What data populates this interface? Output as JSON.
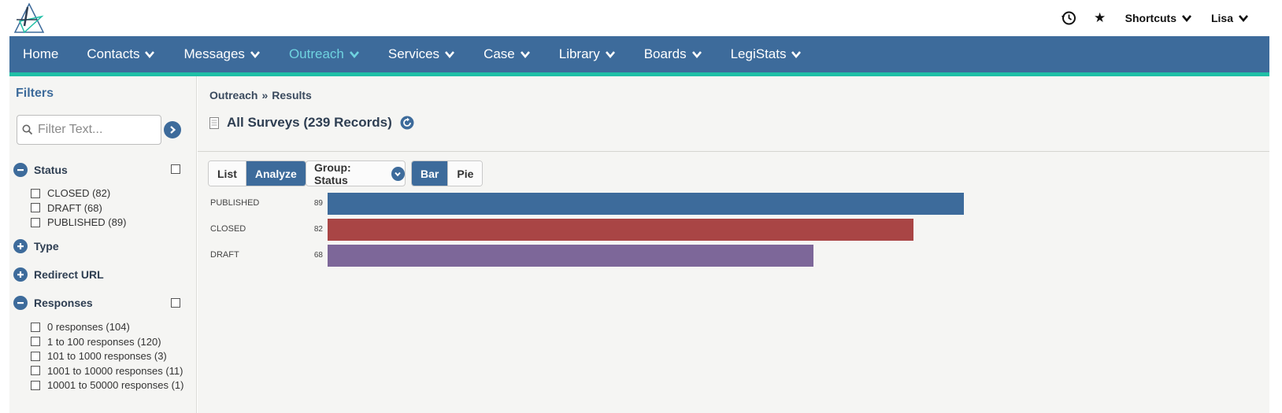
{
  "topbar": {
    "icons": [
      "history-icon",
      "star-icon"
    ],
    "shortcuts_label": "Shortcuts",
    "user_label": "Lisa"
  },
  "nav": {
    "items": [
      {
        "label": "Home",
        "has_menu": false,
        "active": false
      },
      {
        "label": "Contacts",
        "has_menu": true,
        "active": false
      },
      {
        "label": "Messages",
        "has_menu": true,
        "active": false
      },
      {
        "label": "Outreach",
        "has_menu": true,
        "active": true
      },
      {
        "label": "Services",
        "has_menu": true,
        "active": false
      },
      {
        "label": "Case",
        "has_menu": true,
        "active": false
      },
      {
        "label": "Library",
        "has_menu": true,
        "active": false
      },
      {
        "label": "Boards",
        "has_menu": true,
        "active": false
      },
      {
        "label": "LegiStats",
        "has_menu": true,
        "active": false
      }
    ],
    "bg_color": "#3d6b9b",
    "accent_color": "#1fbfa6",
    "active_color": "#6fd3e0"
  },
  "sidebar": {
    "title": "Filters",
    "filter_placeholder": "Filter Text...",
    "filter_value": "",
    "sections": {
      "status": {
        "label": "Status",
        "expanded": true,
        "options": [
          "CLOSED (82)",
          "DRAFT (68)",
          "PUBLISHED (89)"
        ]
      },
      "type": {
        "label": "Type",
        "expanded": false
      },
      "redirect": {
        "label": "Redirect URL",
        "expanded": false
      },
      "responses": {
        "label": "Responses",
        "expanded": true,
        "options": [
          "0 responses (104)",
          "1 to 100 responses (120)",
          "101 to 1000 responses (3)",
          "1001 to 10000 responses (11)",
          "10001 to 50000 responses (1)"
        ]
      }
    }
  },
  "main": {
    "breadcrumb": {
      "parent": "Outreach",
      "separator": "»",
      "current": "Results"
    },
    "records_title": "All Surveys (239 Records)",
    "view_buttons": {
      "list": "List",
      "analyze": "Analyze",
      "selected": "Analyze"
    },
    "group_select": "Group: Status",
    "chart_buttons": {
      "bar": "Bar",
      "pie": "Pie",
      "selected": "Bar"
    }
  },
  "chart_data": {
    "type": "bar",
    "orientation": "horizontal",
    "categories": [
      "PUBLISHED",
      "CLOSED",
      "DRAFT"
    ],
    "values": [
      89,
      82,
      68
    ],
    "colors": [
      "#3d6b9b",
      "#a94545",
      "#7d6799"
    ],
    "title": "",
    "xlabel": "",
    "ylabel": "",
    "grid": false
  }
}
